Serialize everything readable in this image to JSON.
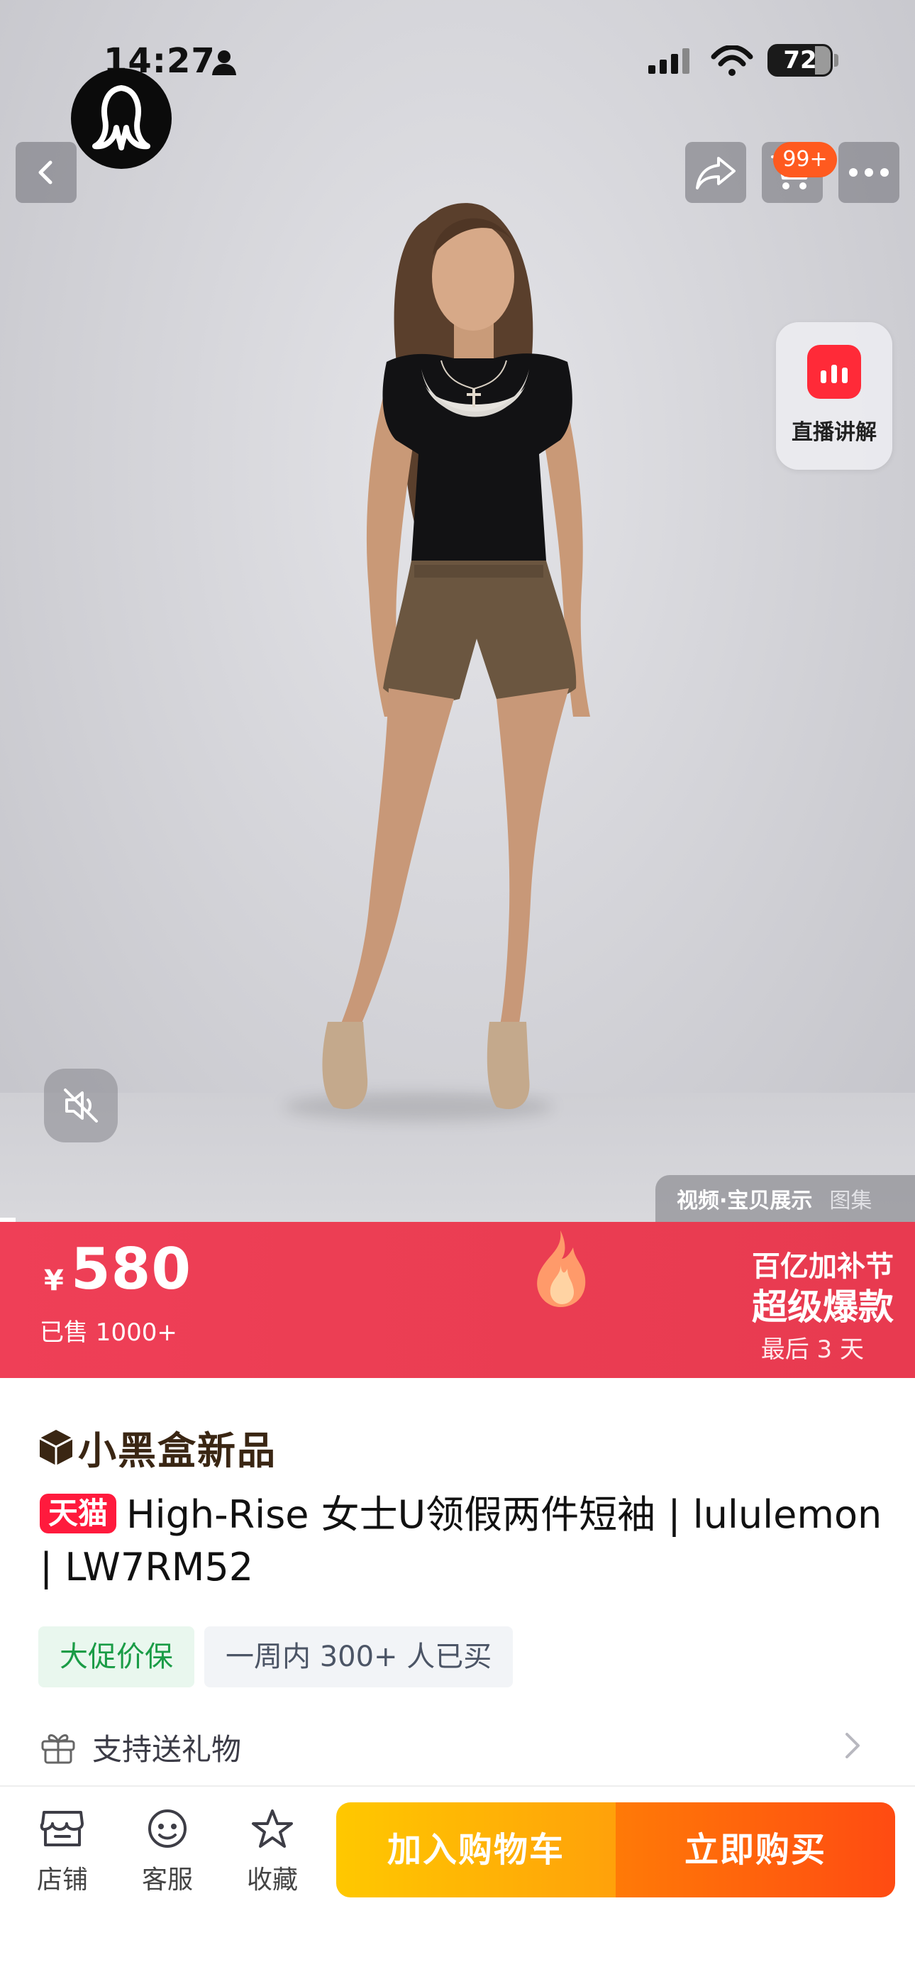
{
  "status_bar": {
    "time": "14:27",
    "battery": "72"
  },
  "top_nav": {
    "cart_badge": "99+"
  },
  "live": {
    "label": "直播讲解"
  },
  "media_tabs": {
    "active": "视频·宝贝展示",
    "other": "图集"
  },
  "price_banner": {
    "currency": "¥",
    "price": "580",
    "sold": "已售 1000+",
    "promo_title": "百亿加补节",
    "promo_sub": "超级爆款",
    "promo_days": "最后 3 天"
  },
  "product": {
    "new_tag": "小黑盒新品",
    "tmall_badge": "天猫",
    "title": "High-Rise 女士U领假两件短袖 | lululemon | LW7RM52",
    "tags": [
      "大促价保",
      "一周内 300+ 人已买"
    ],
    "gift": "支持送礼物"
  },
  "bottom_bar": {
    "store": "店铺",
    "service": "客服",
    "favorite": "收藏",
    "add_to_cart": "加入购物车",
    "buy_now": "立即购买"
  },
  "colors": {
    "price_banner": "#ea3d52",
    "cart_button": "#ffb300",
    "buy_button": "#ff5a0e",
    "tmall": "#ff1a3d"
  }
}
